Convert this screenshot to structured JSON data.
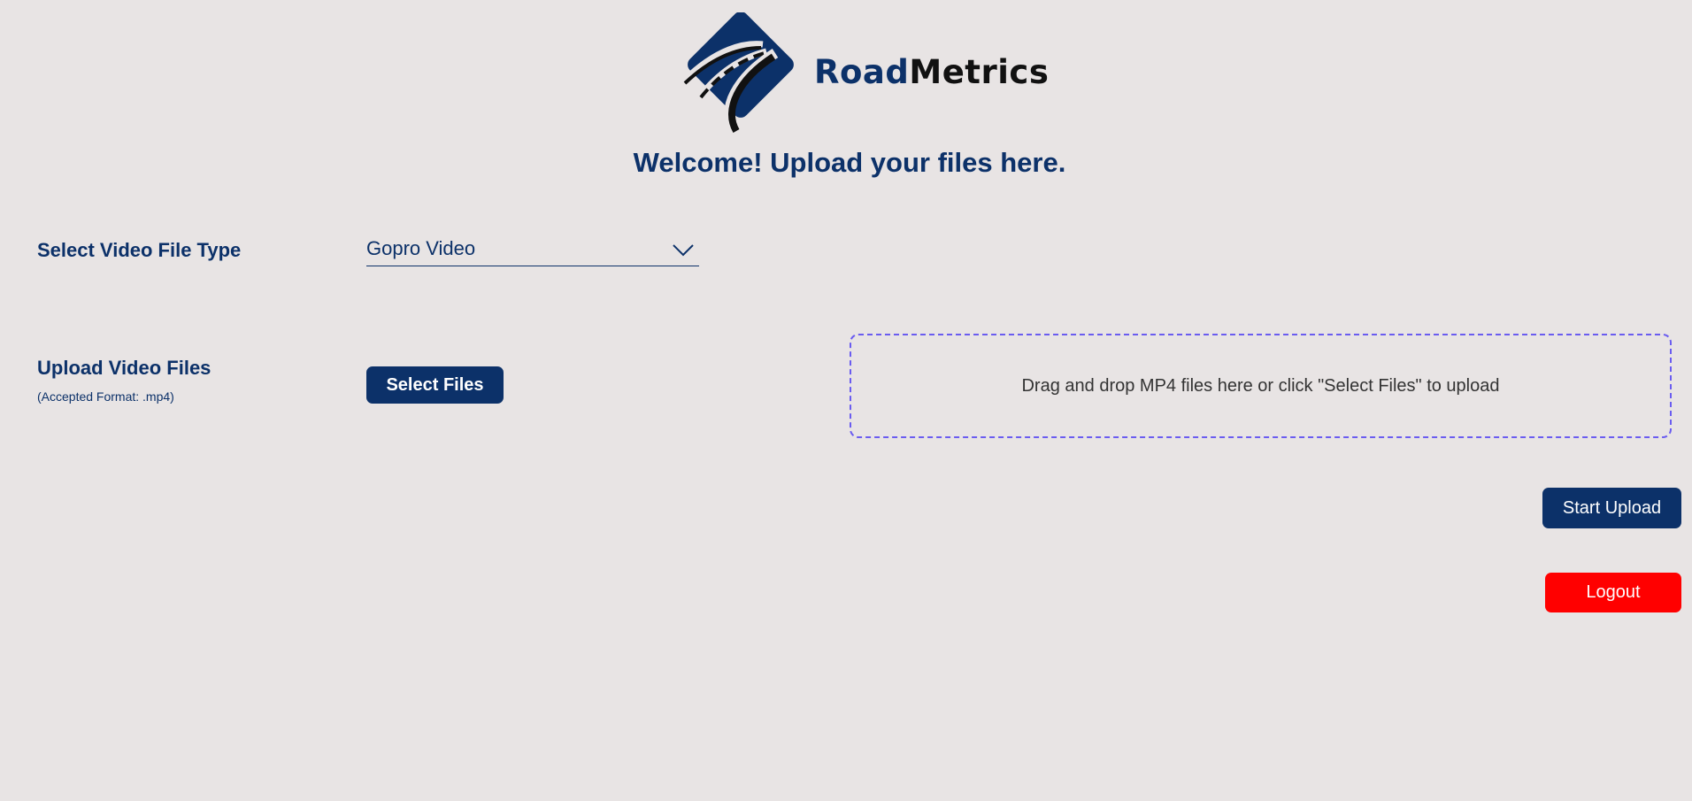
{
  "brand": {
    "name_part1": "Road",
    "name_part2": "Metrics",
    "logo_icon": "road-diamond-icon",
    "primary_color": "#0c3169",
    "text_color": "#111111"
  },
  "page": {
    "title": "Welcome! Upload your files here.",
    "background": "#e8e4e4"
  },
  "file_type": {
    "label": "Select Video File Type",
    "selected_value": "Gopro Video",
    "chevron_icon": "chevron-down-icon"
  },
  "upload": {
    "label": "Upload Video Files",
    "accepted_format": "(Accepted Format: .mp4)",
    "select_button_label": "Select Files",
    "dropzone_text": "Drag and drop MP4 files here or click \"Select Files\" to upload",
    "dropzone_border_color": "#6a5cf0"
  },
  "actions": {
    "start_upload_label": "Start Upload",
    "logout_label": "Logout",
    "logout_color": "#ff0000"
  }
}
